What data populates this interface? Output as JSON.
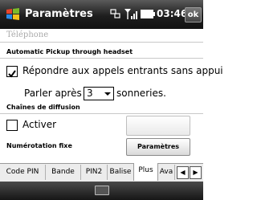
{
  "titlebar": {
    "app_title": "Paramètres",
    "time": "03:46",
    "ok_label": "ok",
    "icons": [
      "windows-logo",
      "data-connection-icon",
      "signal-icon",
      "battery-icon"
    ]
  },
  "page": {
    "title": "Téléphone"
  },
  "auto_pickup": {
    "section_label": "Automatic Pickup through headset",
    "checkbox_label": "Répondre aux appels entrants sans appui",
    "checked": true,
    "rings_prefix": "Parler après",
    "rings_value": "3",
    "rings_suffix": "sonneries."
  },
  "broadcast": {
    "section_label": "Chaînes de diffusion",
    "checkbox_label": "Activer",
    "checked": false,
    "settings_button": ""
  },
  "fixed_dialing": {
    "section_label": "Numérotation fixe",
    "button_label": "Paramètres"
  },
  "tabs": [
    {
      "label": "Code PIN",
      "active": false
    },
    {
      "label": "Bande",
      "active": false
    },
    {
      "label": "PIN2",
      "active": false
    },
    {
      "label": "Balise",
      "active": false
    },
    {
      "label": "Plus",
      "active": true
    },
    {
      "label": "Ava",
      "active": false
    }
  ],
  "tab_scroll": {
    "left": "◀",
    "right": "▶"
  },
  "colors": {
    "titlebar": "#1e1e1e",
    "separator": "#c8c8c8"
  }
}
